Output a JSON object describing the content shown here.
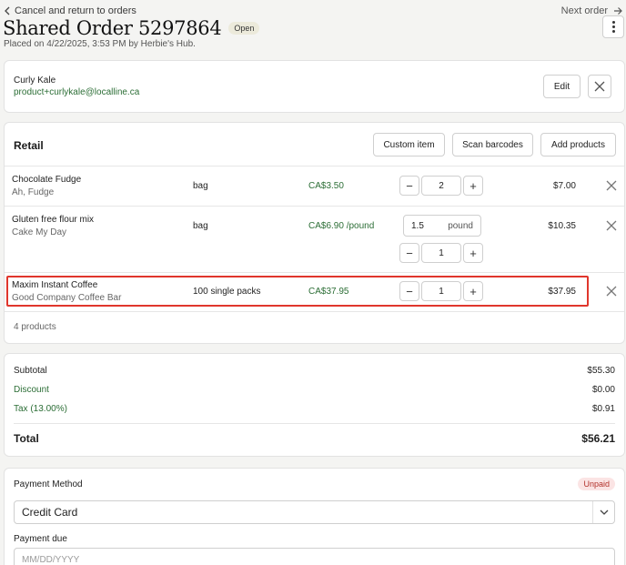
{
  "nav": {
    "back_label": "Cancel and return to orders",
    "next_label": "Next order"
  },
  "header": {
    "title": "Shared Order 5297864",
    "status": "Open",
    "placed": "Placed on 4/22/2025, 3:53 PM by Herbie's Hub."
  },
  "customer": {
    "name": "Curly Kale",
    "email": "product+curlykale@localline.ca",
    "edit_label": "Edit"
  },
  "retail": {
    "title": "Retail",
    "custom_item_label": "Custom item",
    "scan_label": "Scan barcodes",
    "add_label": "Add products",
    "count_label": "4 products",
    "items": [
      {
        "name": "Chocolate Fudge",
        "vendor": "Ah, Fudge",
        "package": "bag",
        "price": "CA$3.50",
        "qty": "2",
        "total": "$7.00"
      },
      {
        "name": "Gluten free flour mix",
        "vendor": "Cake My Day",
        "package": "bag",
        "price": "CA$6.90 /pound",
        "weight": "1.5",
        "weight_unit": "pound",
        "qty": "1",
        "total": "$10.35"
      },
      {
        "name": "Maxim Instant Coffee",
        "vendor": "Good Company Coffee Bar",
        "package": "100 single packs",
        "price": "CA$37.95",
        "qty": "1",
        "total": "$37.95"
      }
    ]
  },
  "summary": {
    "subtotal_label": "Subtotal",
    "subtotal": "$55.30",
    "discount_label": "Discount",
    "discount": "$0.00",
    "tax_label": "Tax (13.00%)",
    "tax": "$0.91",
    "total_label": "Total",
    "total": "$56.21"
  },
  "payment": {
    "method_label": "Payment Method",
    "status": "Unpaid",
    "method_value": "Credit Card",
    "due_label": "Payment due",
    "due_placeholder": "MM/DD/YYYY"
  },
  "colors": {
    "accent_green": "#2c6e36",
    "highlight_red": "#e0362c"
  }
}
